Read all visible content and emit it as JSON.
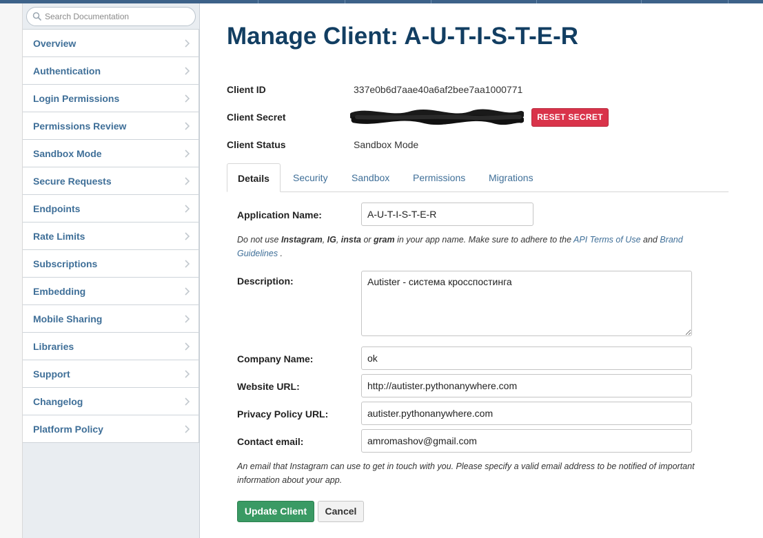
{
  "colors": {
    "topbar": "#3d6289",
    "link": "#3f6f98",
    "title": "#123e62",
    "reset": "#d9334a",
    "update": "#3a9a64"
  },
  "sidebar": {
    "search_placeholder": "Search Documentation",
    "items": [
      {
        "label": "Overview"
      },
      {
        "label": "Authentication"
      },
      {
        "label": "Login Permissions"
      },
      {
        "label": "Permissions Review"
      },
      {
        "label": "Sandbox Mode"
      },
      {
        "label": "Secure Requests"
      },
      {
        "label": "Endpoints"
      },
      {
        "label": "Rate Limits"
      },
      {
        "label": "Subscriptions"
      },
      {
        "label": "Embedding"
      },
      {
        "label": "Mobile Sharing"
      },
      {
        "label": "Libraries"
      },
      {
        "label": "Support"
      },
      {
        "label": "Changelog"
      },
      {
        "label": "Platform Policy"
      }
    ]
  },
  "page": {
    "title": "Manage Client: A-U-T-I-S-T-E-R"
  },
  "client": {
    "id_label": "Client ID",
    "id_value": "337e0b6d7aae40a6af2bee7aa1000771",
    "secret_label": "Client Secret",
    "reset_label": "RESET SECRET",
    "status_label": "Client Status",
    "status_value": "Sandbox Mode"
  },
  "tabs": [
    {
      "label": "Details",
      "active": true
    },
    {
      "label": "Security"
    },
    {
      "label": "Sandbox"
    },
    {
      "label": "Permissions"
    },
    {
      "label": "Migrations"
    }
  ],
  "form": {
    "app_name_label": "Application Name:",
    "app_name_value": "A-U-T-I-S-T-E-R",
    "app_name_help": {
      "p1": "Do not use ",
      "w1": "Instagram",
      "p2": ", ",
      "w2": "IG",
      "p3": ", ",
      "w3": "insta",
      "p4": " or ",
      "w4": "gram",
      "p5": " in your app name. Make sure to adhere to the ",
      "link1": "API Terms of Use",
      "p6": " and ",
      "link2": "Brand Guidelines",
      "p7": " ."
    },
    "description_label": "Description:",
    "description_value": "Autister - система кросспостинга",
    "company_label": "Company Name:",
    "company_value": "ok",
    "website_label": "Website URL:",
    "website_value": "http://autister.pythonanywhere.com",
    "privacy_label": "Privacy Policy URL:",
    "privacy_value": "autister.pythonanywhere.com",
    "email_label": "Contact email:",
    "email_value": "amromashov@gmail.com",
    "email_help": "An email that Instagram can use to get in touch with you. Please specify a valid email address to be notified of important information about your app.",
    "update_label": "Update Client",
    "cancel_label": "Cancel"
  }
}
